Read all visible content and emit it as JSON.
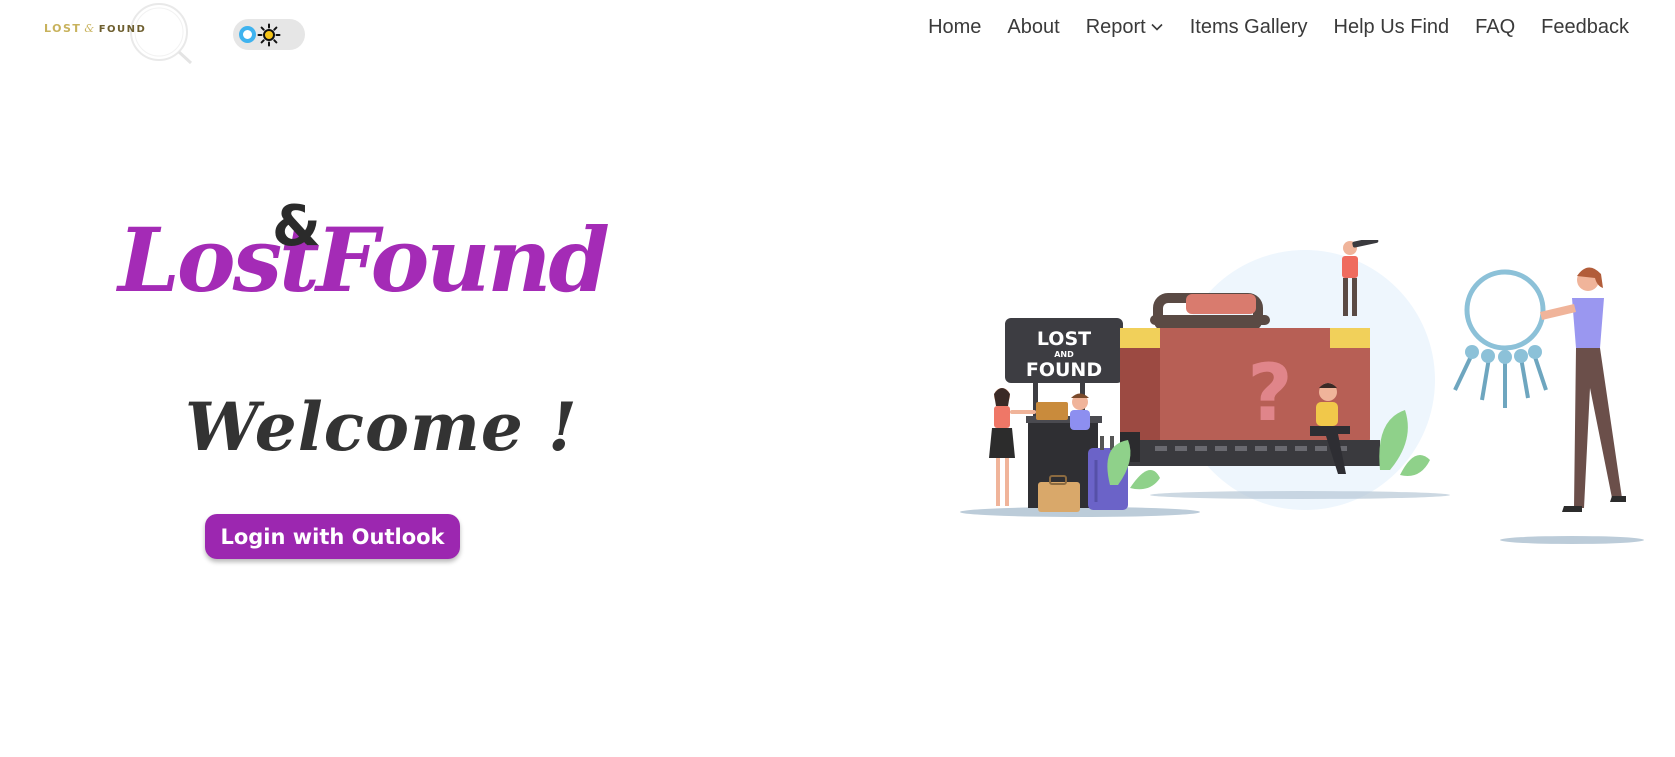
{
  "header": {
    "logo": {
      "word1": "LOST",
      "amp": "&",
      "word2": "FOUND"
    },
    "theme_toggle": {
      "icon": "sun-icon",
      "accent": "#3fb3ef"
    },
    "nav": [
      {
        "label": "Home"
      },
      {
        "label": "About"
      },
      {
        "label": "Report",
        "has_dropdown": true
      },
      {
        "label": "Items Gallery"
      },
      {
        "label": "Help Us Find"
      },
      {
        "label": "FAQ"
      },
      {
        "label": "Feedback"
      }
    ]
  },
  "hero": {
    "brand": {
      "lost": "Lost",
      "amp": "&",
      "found": "Found",
      "color": "#a42bb6"
    },
    "welcome": "Welcome !",
    "login_button": "Login with Outlook",
    "button_color": "#9c27b0",
    "illustration": {
      "sign_line1": "LOST",
      "sign_line2": "AND",
      "sign_line3": "FOUND"
    }
  }
}
